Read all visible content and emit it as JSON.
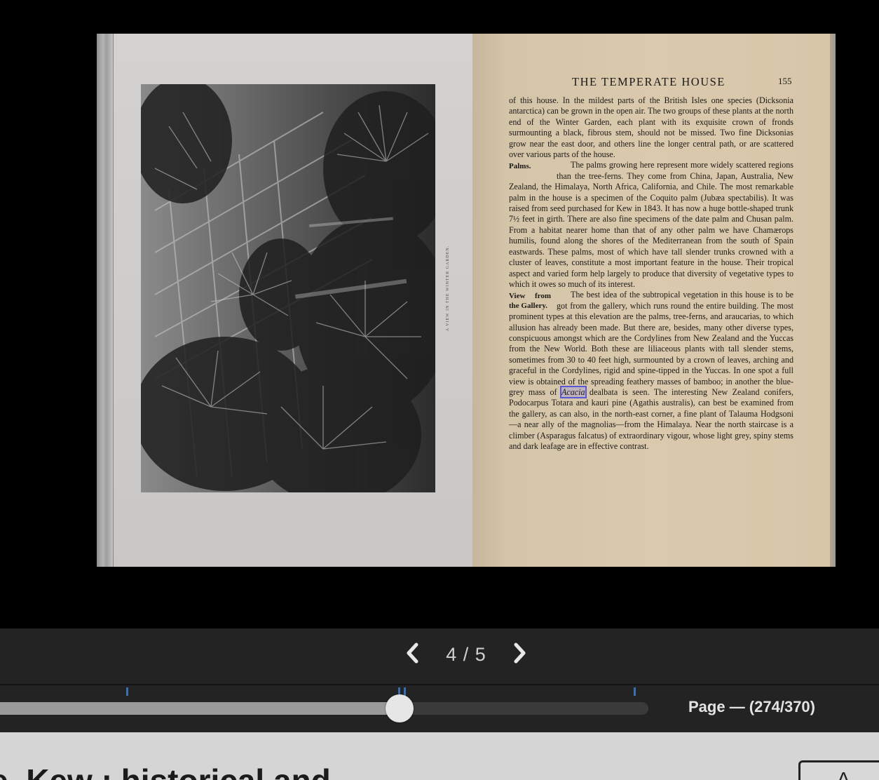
{
  "book": {
    "plate_caption": "A VIEW IN THE WINTER GARDEN.",
    "running_head": "THE TEMPERATE HOUSE",
    "page_number": "155",
    "sidenote_palms": "Palms.",
    "sidenote_gallery": "View from the Gallery.",
    "para1": "of this house. In the mildest parts of the British Isles one species (Dicksonia antarctica) can be grown in the open air. The two groups of these plants at the north end of the Winter Garden, each plant with its exquisite crown of fronds surmounting a black, fibrous stem, should not be missed. Two fine Dicksonias grow near the east door, and others line the longer central path, or are scattered over various parts of the house.",
    "para2": "The palms growing here represent more widely scattered regions than the tree-ferns. They come from China, Japan, Australia, New Zealand, the Himalaya, North Africa, California, and Chile. The most remarkable palm in the house is a specimen of the Coquito palm (Jubæa spectabilis). It was raised from seed purchased for Kew in 1843. It has now a huge bottle-shaped trunk 7½ feet in girth. There are also fine specimens of the date palm and Chusan palm. From a habitat nearer home than that of any other palm we have Chamærops humilis, found along the shores of the Mediterranean from the south of Spain eastwards. These palms, most of which have tall slender trunks crowned with a cluster of leaves, constitute a most important feature in the house. Their tropical aspect and varied form help largely to produce that diversity of vegetative types to which it owes so much of its interest.",
    "para3_a": "The best idea of the subtropical vegetation in this house is to be got from the gallery, which runs round the entire building. The most prominent types at this elevation are the palms, tree-ferns, and araucarias, to which allusion has already been made. But there are, besides, many other diverse types, conspicuous amongst which are the Cordylines from New Zealand and the Yuccas from the New World. Both these are liliaceous plants with tall slender stems, sometimes from 30 to 40 feet high, surmounted by a crown of leaves, arching and graceful in the Cordylines, rigid and spine-tipped in the Yuccas. In one spot a full view is obtained of the spreading feathery masses of bamboo; in another the blue-grey mass of ",
    "para3_highlight": "Acacia",
    "para3_b": " dealbata is seen. The interesting New Zealand conifers, Podocarpus Totara and kauri pine (Agathis australis), can best be examined from the gallery, as can also, in the north-east corner, a fine plant of Talauma Hodgsoni—a near ally of the magnolias—from the Himalaya. Near the north staircase is a climber (Asparagus falcatus) of extraordinary vigour, whose light grey, spiny stems and dark leafage are in effective contrast."
  },
  "controls": {
    "page_counter": "4 / 5",
    "page_info": "Page — (274/370)",
    "progress": 0.62,
    "search_markers": [
      0.204,
      0.619,
      0.628,
      0.979
    ]
  },
  "info": {
    "title": "ne, Kew : historical and",
    "font_button": "A"
  },
  "icons": {
    "prev": "chevron-left-icon",
    "next": "chevron-right-icon"
  }
}
